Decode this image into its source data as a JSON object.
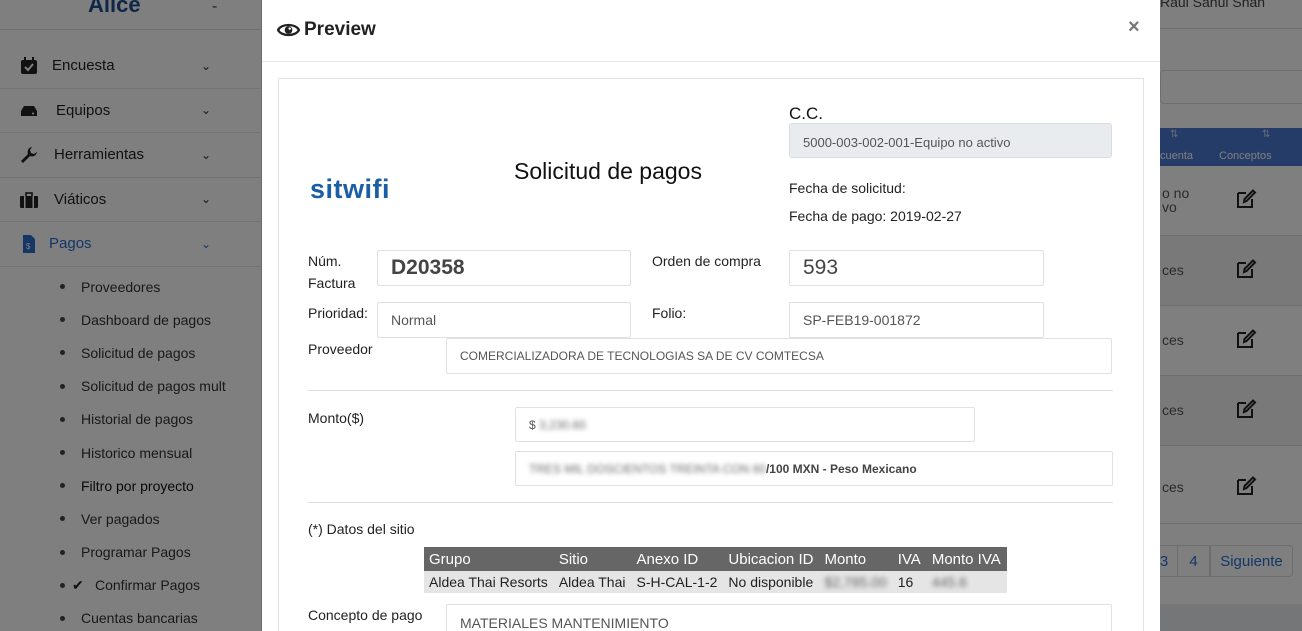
{
  "sidebar": {
    "brand": "Alice",
    "brand_suffix": "-",
    "menu": [
      {
        "label": "Encuesta",
        "icon": "calendar-check-icon"
      },
      {
        "label": "Equipos",
        "icon": "hard-drive-icon"
      },
      {
        "label": "Herramientas",
        "icon": "wrench-icon"
      },
      {
        "label": "Viáticos",
        "icon": "briefcase-icon"
      },
      {
        "label": "Pagos",
        "icon": "invoice-icon",
        "active": true
      }
    ],
    "submenu": [
      {
        "label": "Proveedores"
      },
      {
        "label": "Dashboard de pagos"
      },
      {
        "label": "Solicitud de pagos"
      },
      {
        "label": "Solicitud de pagos mult"
      },
      {
        "label": "Historial de pagos"
      },
      {
        "label": "Historico mensual"
      },
      {
        "label": "Filtro por proyecto"
      },
      {
        "label": "Ver pagados"
      },
      {
        "label": "Programar Pagos"
      },
      {
        "label": "Confirmar Pagos",
        "checked": true
      },
      {
        "label": "Cuentas bancarias"
      }
    ]
  },
  "topbar": {
    "user": "Raul Sanui Shan"
  },
  "table_bg": {
    "headers": [
      "cuenta",
      "Conceptos"
    ],
    "rows": [
      "o no\nvo",
      "ces",
      "ces",
      "ces",
      "ces"
    ],
    "pager": [
      "3",
      "4",
      "Siguiente"
    ]
  },
  "modal": {
    "title": "Preview",
    "close": "×",
    "logo_part1": "sit",
    "logo_part2": "wifi",
    "doc_title": "Solicitud de pagos",
    "cc_label": "C.C.",
    "cc_value": "5000-003-002-001-Equipo no activo",
    "fecha_solicitud_label": "Fecha de solicitud:",
    "fecha_pago_label": "Fecha de pago: 2019-02-27",
    "num_factura_label_1": "Núm.",
    "num_factura_label_2": "Factura",
    "num_factura": "D20358",
    "orden_compra_label": "Orden de compra",
    "orden_compra": "593",
    "prioridad_label": "Prioridad:",
    "prioridad": "Normal",
    "folio_label": "Folio:",
    "folio": "SP-FEB19-001872",
    "proveedor_label": "Proveedor",
    "proveedor": "COMERCIALIZADORA DE TECNOLOGIAS SA DE CV COMTECSA",
    "monto_label": "Monto($)",
    "monto_prefix": "$",
    "monto_value": "3,230.60",
    "monto_letra_blur": "TRES MIL DOSCIENTOS TREINTA CON 60",
    "monto_letra_suffix": "/100 MXN - Peso Mexicano",
    "datos_sitio_label": "(*) Datos del sitio",
    "site_table": {
      "headers": [
        "Grupo",
        "Sitio",
        "Anexo ID",
        "Ubicacion ID",
        "Monto",
        "IVA",
        "Monto IVA"
      ],
      "row": [
        "Aldea Thai Resorts",
        "Aldea Thai",
        "S-H-CAL-1-2",
        "No disponible",
        "$2,785.00",
        "16",
        "445.6"
      ]
    },
    "concepto_label": "Concepto de pago",
    "concepto": "MATERIALES MANTENIMIENTO"
  }
}
